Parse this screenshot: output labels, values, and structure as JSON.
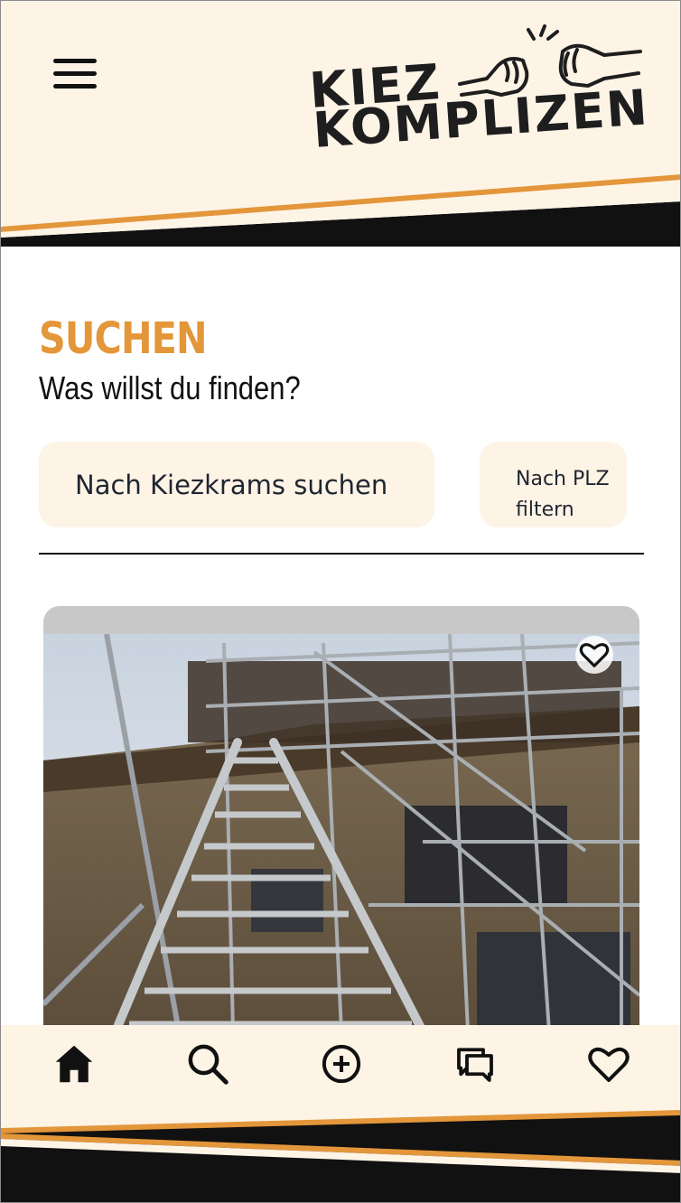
{
  "app": {
    "logo_line1": "KIEZ",
    "logo_line2": "KOMPLIZEN"
  },
  "colors": {
    "accent": "#e3963a",
    "cream": "#fdf4e6",
    "dark": "#111111"
  },
  "header": {
    "menu_icon": "hamburger-menu-icon"
  },
  "search": {
    "title": "SUCHEN",
    "subtitle": "Was willst du finden?",
    "input_placeholder": "Nach Kiezkrams suchen",
    "plz_line1": "Nach PLZ",
    "plz_line2": "filtern"
  },
  "results": [
    {
      "image": "scaffolding-ladder-photo",
      "favorite_icon": "heart-outline-icon"
    }
  ],
  "bottom_nav": [
    {
      "name": "home",
      "icon": "home-icon",
      "active": true
    },
    {
      "name": "search",
      "icon": "search-icon",
      "active": false
    },
    {
      "name": "add",
      "icon": "plus-circle-icon",
      "active": false
    },
    {
      "name": "messages",
      "icon": "chat-bubbles-icon",
      "active": false
    },
    {
      "name": "favorites",
      "icon": "heart-icon",
      "active": false
    }
  ]
}
